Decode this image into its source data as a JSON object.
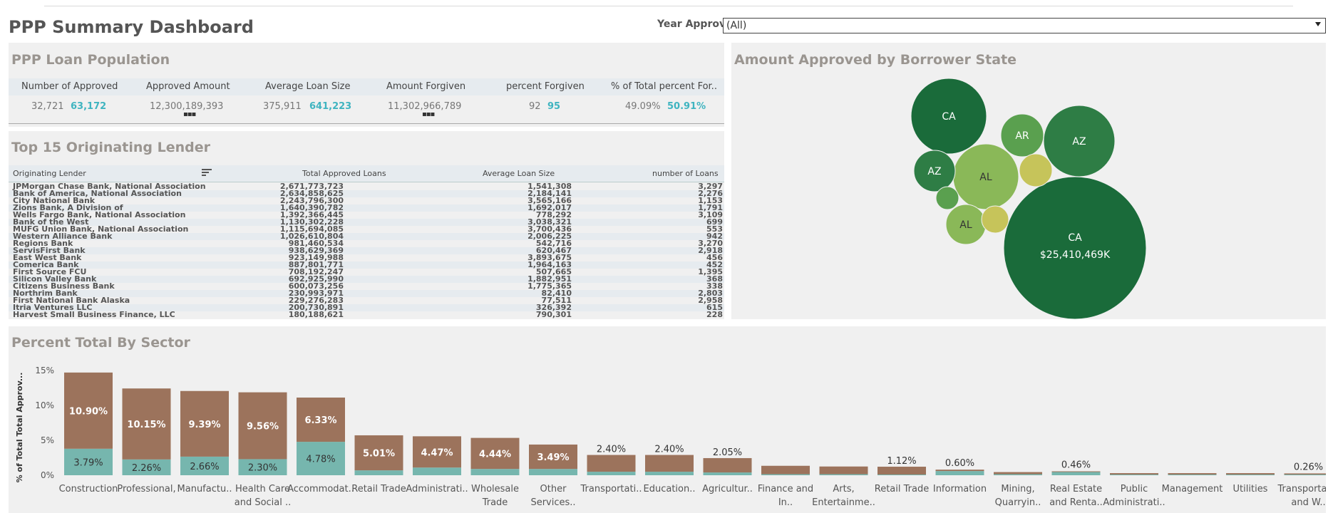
{
  "page_title": "PPP Summary Dashboard",
  "filter": {
    "label": "Year Approv...",
    "value": "(All)"
  },
  "population": {
    "title": "PPP Loan Population",
    "headers": [
      "Number of Approved",
      "Approved Amount",
      "Average Loan Size",
      "Amount Forgiven",
      "percent Forgiven",
      "% of Total percent For.."
    ],
    "values": [
      "32,721",
      "12,300,189,393",
      "375,911",
      "11,302,966,789",
      "92",
      "49.09%"
    ],
    "highlight": [
      "63,172",
      "",
      "641,223",
      "",
      "95",
      "50.91%"
    ]
  },
  "lenders": {
    "title": "Top 15 Originating Lender",
    "headers": [
      "Originating Lender",
      "Total Approved Loans",
      "Average Loan Size",
      "number of Loans"
    ],
    "rows": [
      [
        "JPMorgan Chase Bank, National Association",
        "2,671,773,723",
        "1,541,308",
        "3,297"
      ],
      [
        "Bank of America, National Association",
        "2,634,858,625",
        "2,184,141",
        "2,276"
      ],
      [
        "City National Bank",
        "2,243,796,300",
        "3,565,166",
        "1,153"
      ],
      [
        "Zions Bank, A Division of",
        "1,640,390,782",
        "1,692,017",
        "1,791"
      ],
      [
        "Wells Fargo Bank, National Association",
        "1,392,366,445",
        "778,292",
        "3,109"
      ],
      [
        "Bank of the West",
        "1,130,302,228",
        "3,038,321",
        "699"
      ],
      [
        "MUFG Union Bank, National Association",
        "1,115,694,085",
        "3,700,436",
        "553"
      ],
      [
        "Western Alliance Bank",
        "1,026,610,804",
        "2,006,225",
        "942"
      ],
      [
        "Regions Bank",
        "981,460,534",
        "542,716",
        "3,270"
      ],
      [
        "ServisFirst Bank",
        "938,629,369",
        "620,467",
        "2,918"
      ],
      [
        "East West Bank",
        "923,149,988",
        "3,893,675",
        "456"
      ],
      [
        "Comerica Bank",
        "887,801,771",
        "1,964,163",
        "452"
      ],
      [
        "First Source FCU",
        "708,192,247",
        "507,665",
        "1,395"
      ],
      [
        "Silicon Valley Bank",
        "692,925,990",
        "1,882,951",
        "368"
      ],
      [
        "Citizens Business Bank",
        "600,073,256",
        "1,775,365",
        "338"
      ],
      [
        "Northrim Bank",
        "230,993,971",
        "82,410",
        "2,803"
      ],
      [
        "First National Bank Alaska",
        "229,276,283",
        "77,511",
        "2,958"
      ],
      [
        "Itria Ventures LLC",
        "200,730,891",
        "326,392",
        "615"
      ],
      [
        "Harvest Small Business Finance, LLC",
        "180,188,621",
        "790,301",
        "228"
      ]
    ]
  },
  "state": {
    "title": "Amount Approved by Borrower State",
    "bubbles": [
      {
        "label": "CA",
        "sub": "$25,410,469K",
        "color": "#1a6b3a"
      },
      {
        "label": "CA",
        "sub": "",
        "color": "#1a6b3a"
      },
      {
        "label": "AZ",
        "sub": "",
        "color": "#2e7d45"
      },
      {
        "label": "AR",
        "sub": "",
        "color": "#5aa04f"
      },
      {
        "label": "AL",
        "sub": "",
        "color": "#8ab858"
      },
      {
        "label": "AZ",
        "sub": "",
        "color": "#2e7d45"
      },
      {
        "label": "AL",
        "sub": "",
        "color": "#8ab858"
      },
      {
        "label": "",
        "sub": "",
        "color": "#c6c45a"
      },
      {
        "label": "",
        "sub": "",
        "color": "#c6c45a"
      },
      {
        "label": "",
        "sub": "",
        "color": "#5aa04f"
      }
    ]
  },
  "chart_data": {
    "type": "bar",
    "title": "Percent Total By Sector",
    "ylabel": "% of Total Total Approv...",
    "yticks": [
      "15%",
      "10%",
      "5%",
      "0%"
    ],
    "ylim": [
      0,
      16
    ],
    "colors": {
      "top": "#9c735c",
      "bottom": "#76b6ae"
    },
    "categories": [
      [
        "Construction",
        ""
      ],
      [
        "Professional,",
        ""
      ],
      [
        "Manufactu..",
        ""
      ],
      [
        "Health Care",
        "and Social .."
      ],
      [
        "Accommodat..",
        ""
      ],
      [
        "Retail Trade",
        ""
      ],
      [
        "Administrati..",
        ""
      ],
      [
        "Wholesale",
        "Trade"
      ],
      [
        "Other",
        "Services.."
      ],
      [
        "Transportati..",
        ""
      ],
      [
        "Education..",
        ""
      ],
      [
        "Agricultur..",
        ""
      ],
      [
        "Finance and",
        "In.."
      ],
      [
        "Arts,",
        "Entertainme.."
      ],
      [
        "Retail Trade",
        ""
      ],
      [
        "Information",
        ""
      ],
      [
        "Mining,",
        "Quarryin.."
      ],
      [
        "Real Estate",
        "and Renta.."
      ],
      [
        "Public",
        "Administrati.."
      ],
      [
        "Management",
        ""
      ],
      [
        "Utilities",
        ""
      ],
      [
        "Transportati..",
        "and W.."
      ]
    ],
    "series": [
      {
        "values": [
          10.9,
          10.15,
          9.39,
          9.56,
          6.33,
          5.01,
          4.47,
          4.44,
          3.49,
          2.4,
          2.4,
          2.05,
          1.2,
          1.1,
          1.12,
          0.2,
          0.3,
          0.1,
          0.2,
          0.2,
          0.2,
          0.16
        ],
        "labels": [
          "10.90%",
          "10.15%",
          "9.39%",
          "9.56%",
          "6.33%",
          "5.01%",
          "4.47%",
          "4.44%",
          "3.49%",
          "2.40%",
          "2.40%",
          "2.05%",
          "",
          "",
          "1.12%",
          "",
          "",
          "",
          "",
          "",
          "",
          ""
        ]
      },
      {
        "values": [
          3.79,
          2.26,
          2.66,
          2.3,
          4.78,
          0.7,
          1.1,
          0.9,
          0.9,
          0.5,
          0.5,
          0.4,
          0.15,
          0.15,
          0.1,
          0.6,
          0.15,
          0.46,
          0.1,
          0.1,
          0.1,
          0.1
        ],
        "labels": [
          "3.79%",
          "2.26%",
          "2.66%",
          "2.30%",
          "4.78%",
          "",
          "",
          "",
          "",
          "",
          "",
          "",
          "",
          "",
          "",
          "",
          "",
          "",
          "",
          "",
          "",
          ""
        ]
      }
    ],
    "total_labels": [
      "",
      "",
      "",
      "",
      "",
      "",
      "",
      "",
      "",
      "",
      "",
      "",
      "",
      "",
      "",
      "0.60%",
      "",
      "0.46%",
      "",
      "",
      "",
      "0.26%"
    ]
  }
}
